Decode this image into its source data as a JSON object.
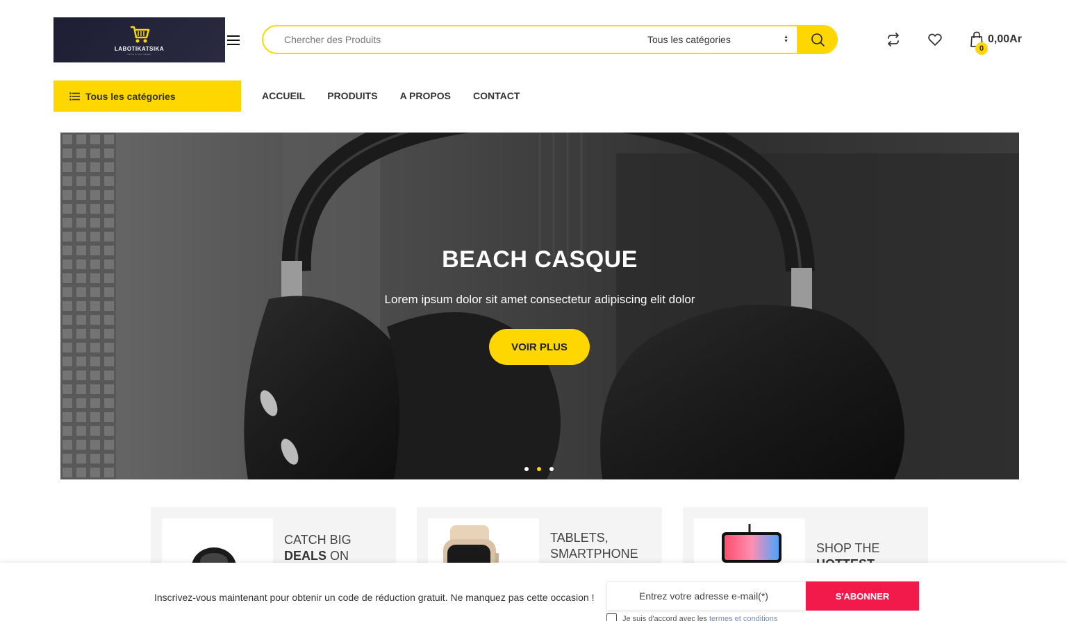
{
  "brand": {
    "name": "LABOTIKATSIKA",
    "tagline": "marché en ligne malagasy"
  },
  "search": {
    "placeholder": "Chercher des Produits",
    "category": "Tous les catégories"
  },
  "cart": {
    "count": "0",
    "total": "0,00Ar"
  },
  "nav": {
    "categories_label": "Tous les catégories",
    "links": [
      "ACCUEIL",
      "PRODUITS",
      "A PROPOS",
      "CONTACT"
    ]
  },
  "hero": {
    "title": "BEACH CASQUE",
    "subtitle": "Lorem ipsum dolor sit amet consectetur adipiscing elit dolor",
    "button": "VOIR PLUS",
    "slide_count": 3,
    "active_slide": 2
  },
  "promos": [
    {
      "line1": "CATCH BIG",
      "line2_bold": "DEALS",
      "line2_rest": " ON"
    },
    {
      "line1": "TABLETS,",
      "line2": "SMARTPHONE"
    },
    {
      "line1": "SHOP THE",
      "line2_bold": "HOTTEST"
    }
  ],
  "newsletter": {
    "text": "Inscrivez-vous maintenant pour obtenir un code de réduction gratuit. Ne manquez pas cette occasion !",
    "placeholder": "Entrez votre adresse e-mail(*)",
    "button": "S'ABONNER",
    "agree": "Je suis d'accord avec les",
    "terms": "termes et conditions"
  },
  "colors": {
    "accent": "#fed700",
    "subscribe": "#f2194b"
  }
}
